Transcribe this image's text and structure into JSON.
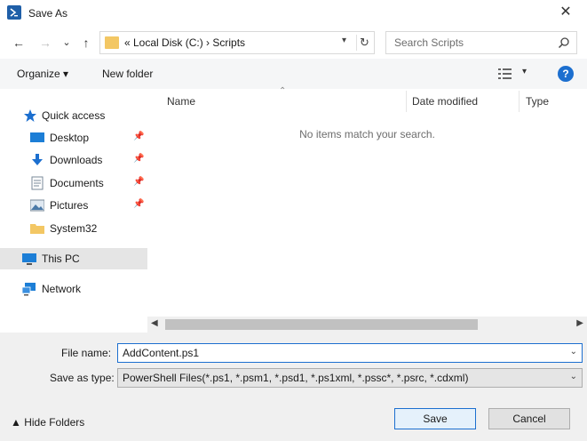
{
  "window": {
    "title": "Save As",
    "close_glyph": "✕"
  },
  "nav": {
    "back_glyph": "←",
    "forward_glyph": "→",
    "recent_glyph": "⌄",
    "up_glyph": "↑"
  },
  "address": {
    "overflow": "«",
    "segments": [
      "Local Disk (C:)",
      "Scripts"
    ],
    "separator": "›",
    "text": "«  Local Disk (C:)  ›  Scripts"
  },
  "search": {
    "placeholder": "Search Scripts"
  },
  "toolbar": {
    "organize_label": "Organize ▾",
    "new_folder_label": "New folder"
  },
  "sidebar": {
    "items": [
      {
        "label": "Quick access",
        "icon": "star-icon"
      },
      {
        "label": "Desktop",
        "icon": "desktop-icon",
        "pinned": true
      },
      {
        "label": "Downloads",
        "icon": "download-icon",
        "pinned": true
      },
      {
        "label": "Documents",
        "icon": "document-icon",
        "pinned": true
      },
      {
        "label": "Pictures",
        "icon": "picture-icon",
        "pinned": true
      },
      {
        "label": "System32",
        "icon": "folder-icon"
      },
      {
        "label": "This PC",
        "icon": "computer-icon",
        "selected": true
      },
      {
        "label": "Network",
        "icon": "network-icon"
      }
    ]
  },
  "columns": [
    "Name",
    "Date modified",
    "Type"
  ],
  "empty_message": "No items match your search.",
  "form": {
    "file_name_label": "File name:",
    "file_name_value": "AddContent.ps1",
    "save_type_label": "Save as type:",
    "save_type_value": "PowerShell Files(*.ps1, *.psm1, *.psd1, *.ps1xml, *.pssc*, *.psrc, *.cdxml)"
  },
  "footer": {
    "hide_folders_label": "▲  Hide Folders",
    "save_label": "Save",
    "cancel_label": "Cancel"
  },
  "colors": {
    "accent": "#1c6fcf",
    "selection": "#e5e5e5",
    "folder": "#f3c764",
    "toolbar_bg": "#f5f6f7",
    "footer_bg": "#f0f0f0"
  }
}
